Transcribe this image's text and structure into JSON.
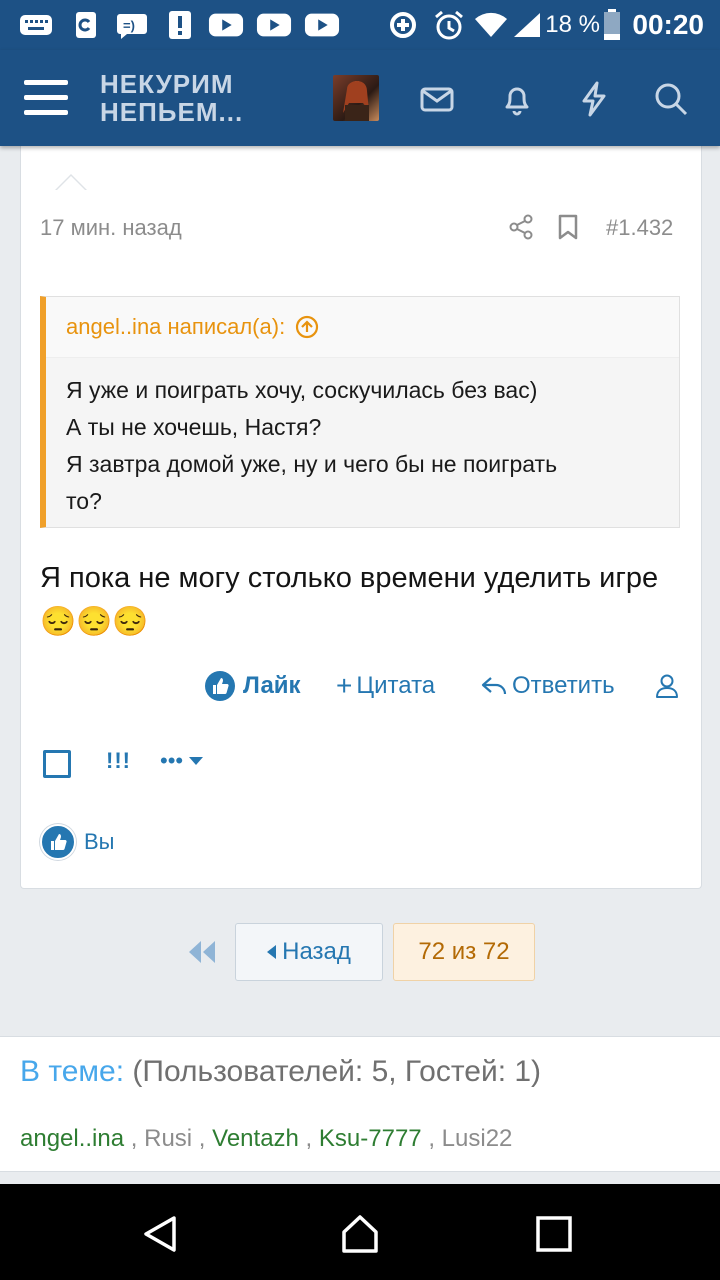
{
  "status_bar": {
    "battery_percent": "18 %",
    "time": "00:20",
    "left_icons": [
      "keyboard-icon",
      "clipboard-icon",
      "voicemail-icon",
      "alert-icon",
      "youtube-icon",
      "youtube-icon",
      "youtube-icon"
    ],
    "right_icons": [
      "data-saver-icon",
      "alarm-icon",
      "wifi-icon",
      "signal-icon",
      "battery-icon"
    ]
  },
  "app_bar": {
    "logo_line1": "НЕКУРИМ",
    "logo_line2": "НЕПЬЕМ...",
    "icons": [
      "menu-icon",
      "avatar",
      "mail-icon",
      "bell-icon",
      "lightning-icon",
      "search-icon"
    ]
  },
  "post": {
    "time": "17 мин. назад",
    "number": "#1.432",
    "quote": {
      "author": "angel..ina написал(а):",
      "lines": [
        "Я уже и поиграть хочу, соскучилась без вас)",
        "А ты не хочешь, Настя?",
        "Я завтра домой уже, ну и чего бы не поиграть",
        "то?"
      ]
    },
    "text": "Я пока не могу столько времени уделить игре 😔😔😔",
    "actions": {
      "like": "Лайк",
      "quote": "Цитата",
      "reply": "Ответить"
    },
    "warn": "!!!",
    "more": "•••",
    "likes_text": "Вы"
  },
  "pagination": {
    "back": "Назад",
    "current": "72 из 72"
  },
  "in_theme": {
    "label": "В теме:",
    "counts": "(Пользователей: 5, Гостей: 1)",
    "users": [
      {
        "name": "angel..ina",
        "style": "link"
      },
      {
        "name": "Rusi",
        "style": "plain"
      },
      {
        "name": "Ventazh",
        "style": "link"
      },
      {
        "name": "Ksu-7777",
        "style": "link"
      },
      {
        "name": "Lusi22",
        "style": "plain"
      }
    ]
  },
  "colors": {
    "header": "#1d5185",
    "accent": "#2577b1",
    "quote_border": "#f0a02a",
    "quote_author": "#e8930e",
    "user_link": "#2e7d32"
  }
}
